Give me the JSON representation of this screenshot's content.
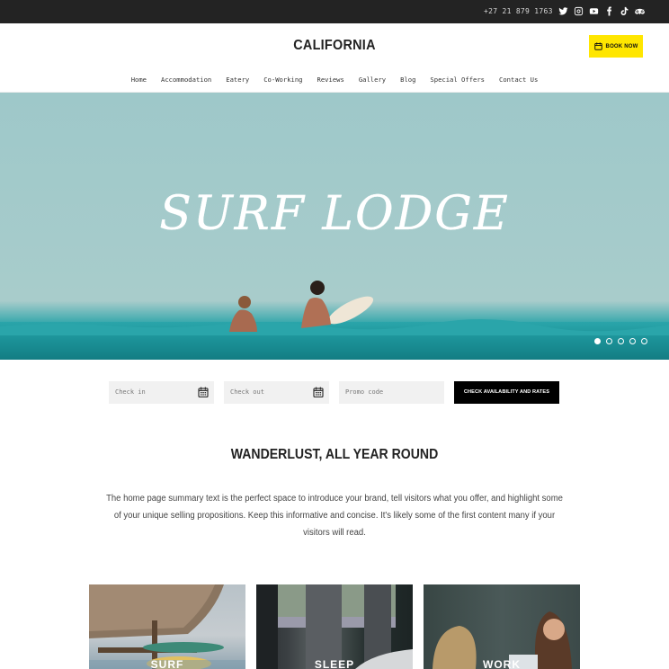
{
  "topbar": {
    "phone": "+27 21 879 1763",
    "socials": [
      "twitter-icon",
      "instagram-icon",
      "youtube-icon",
      "facebook-icon",
      "tiktok-icon",
      "tripadvisor-icon"
    ]
  },
  "header": {
    "logo": "CALIFORNIA",
    "book_now": "BOOK NOW"
  },
  "nav": [
    "Home",
    "Accommodation",
    "Eatery",
    "Co-Working",
    "Reviews",
    "Gallery",
    "Blog",
    "Special Offers",
    "Contact Us"
  ],
  "hero": {
    "title": "SURF LODGE",
    "slides_total": 5,
    "active_slide": 1
  },
  "booking": {
    "check_in_placeholder": "Check in",
    "check_out_placeholder": "Check out",
    "promo_placeholder": "Promo code",
    "submit_label": "CHECK AVAILABILITY AND RATES"
  },
  "intro": {
    "title": "WANDERLUST, ALL YEAR ROUND",
    "text": "The home page summary text is the perfect space to introduce your brand, tell visitors what you offer, and highlight some of your unique selling propositions. Keep this informative and concise. It's likely some of the first content many if your visitors will read."
  },
  "cards": [
    {
      "label": "SURF"
    },
    {
      "label": "SLEEP"
    },
    {
      "label": "WORK"
    }
  ],
  "colors": {
    "accent": "#ffe600",
    "topbar": "#232323"
  }
}
